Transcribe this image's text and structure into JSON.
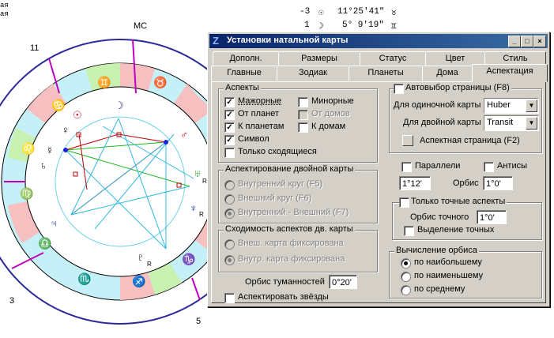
{
  "header": {
    "left_lines": [
      "ая",
      "ая"
    ],
    "row1": {
      "num": "-3",
      "glyph": "☉",
      "pos": "11°25'41\"",
      "sign": "♉"
    },
    "row2": {
      "num": "1",
      "glyph": "☽",
      "pos": "5° 9'19\"",
      "sign": "♊"
    }
  },
  "chart": {
    "mc_label": "MC",
    "house_labels": {
      "h11": "11",
      "h3": "3",
      "h5": "5"
    },
    "planet_glyphs": {
      "sun": "☉",
      "moon": "☽",
      "mercury": "☿",
      "venus": "♀",
      "mars": "♂",
      "jupiter": "♃",
      "saturn": "♄",
      "uranus": "♅",
      "neptune": "♆",
      "pluto": "♇"
    },
    "sign_glyphs": [
      "♈",
      "♉",
      "♊",
      "♋",
      "♌",
      "♍",
      "♎",
      "♏",
      "♐",
      "♑",
      "♒",
      "♓"
    ],
    "retro": "R"
  },
  "dialog": {
    "title": "Установки натальной карты",
    "app_icon": "Z",
    "window_buttons": {
      "minimize": "_",
      "maximize": "□",
      "close": "×"
    },
    "tabs_row1": [
      "Дополн.",
      "Размеры",
      "Статус",
      "Цвет",
      "Стиль"
    ],
    "tabs_row2": [
      "Главные",
      "Зодиак",
      "Планеты",
      "Дома",
      "Аспектация"
    ],
    "aspects": {
      "title": "Аспекты",
      "major": "Мажорные",
      "minor": "Минорные",
      "from_planets": "От планет",
      "from_houses": "От домов",
      "to_planets": "К планетам",
      "to_houses": "К домам",
      "symbol": "Символ",
      "only_converging": "Только сходящиеся"
    },
    "double_chart": {
      "title": "Аспектирование двойной карты",
      "inner": "Внутренний круг  (F5)",
      "outer": "Внешний круг  (F6)",
      "inner_outer": "Внутренний - Внешний  (F7)"
    },
    "convergence": {
      "title": "Сходимость аспектов дв. карты",
      "outer_fixed": "Внеш. карта фиксирована",
      "inner_fixed": "Внутр. карта фиксирована"
    },
    "nebula_orb": {
      "label": "Орбис туманностей",
      "value": "0°20'"
    },
    "aspect_stars": "Аспектировать звёзды",
    "auto_page": {
      "label": "Автовыбор страницы  (F8)",
      "single_label": "Для одиночной карты",
      "single_value": "Huber",
      "double_label": "Для двойной карты",
      "double_value": "Transit",
      "aspect_page_button": "Аспектная страница (F2)"
    },
    "parallels": {
      "parallels_label": "Параллели",
      "antiscia_label": "Антисы",
      "left_value": "1°12'",
      "orb_label": "Орбис",
      "orb_value": "1°0'"
    },
    "exact": {
      "title": "Только точные аспекты",
      "orb_label": "Орбис точного",
      "orb_value": "1°0'",
      "highlight": "Выделение точных"
    },
    "orb_calc": {
      "title": "Вычисление орбиса",
      "largest": "по наибольшему",
      "smallest": "по наименьшему",
      "average": "по среднему"
    }
  }
}
